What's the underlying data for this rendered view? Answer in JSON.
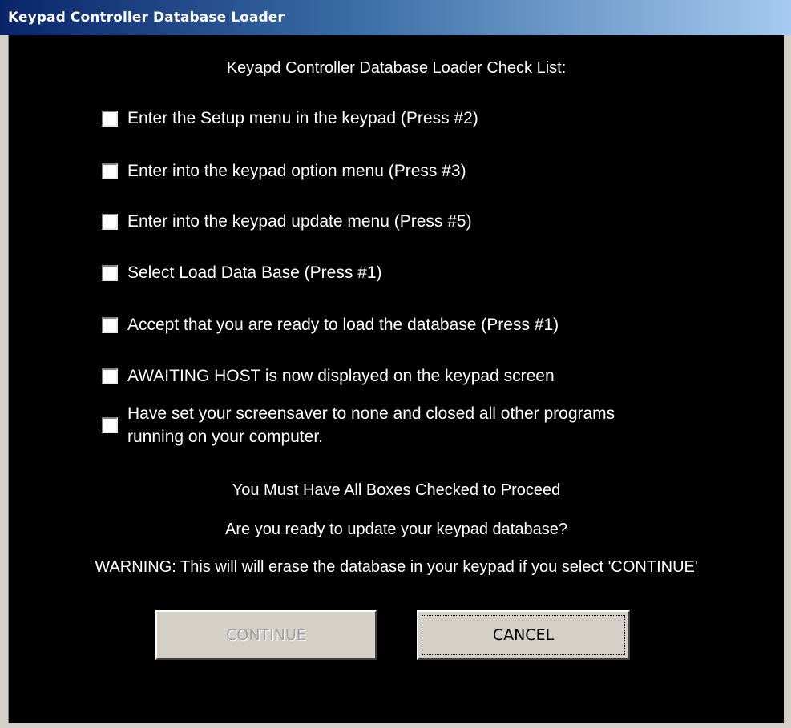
{
  "window": {
    "title": "Keypad Controller Database Loader"
  },
  "heading": "Keyapd Controller Database Loader Check List:",
  "checklist": [
    {
      "label": "Enter the Setup menu in the keypad (Press #2)",
      "checked": false
    },
    {
      "label": "Enter into the keypad option menu (Press #3)",
      "checked": false
    },
    {
      "label": "Enter into the keypad update menu (Press #5)",
      "checked": false
    },
    {
      "label": "Select Load Data Base (Press #1)",
      "checked": false
    },
    {
      "label": "Accept that you are ready to load the database (Press #1)",
      "checked": false
    },
    {
      "label": "AWAITING HOST is now displayed on the keypad screen",
      "checked": false
    },
    {
      "label": "Have set your screensaver to none and closed all other programs running on your computer.",
      "checked": false
    }
  ],
  "notes": {
    "must_check": "You Must Have All Boxes Checked to Proceed",
    "ready_question": "Are you ready to update your keypad database?",
    "warning": "WARNING: This will will erase the database  in your keypad if you select 'CONTINUE'"
  },
  "buttons": {
    "continue_label": "CONTINUE",
    "continue_enabled": false,
    "cancel_label": "CANCEL"
  },
  "colors": {
    "title_bar": "#0a246a",
    "client_background": "#000000",
    "text": "#ffffff",
    "button_face": "#d4d0c8",
    "disabled_text": "#a0a0a0"
  }
}
